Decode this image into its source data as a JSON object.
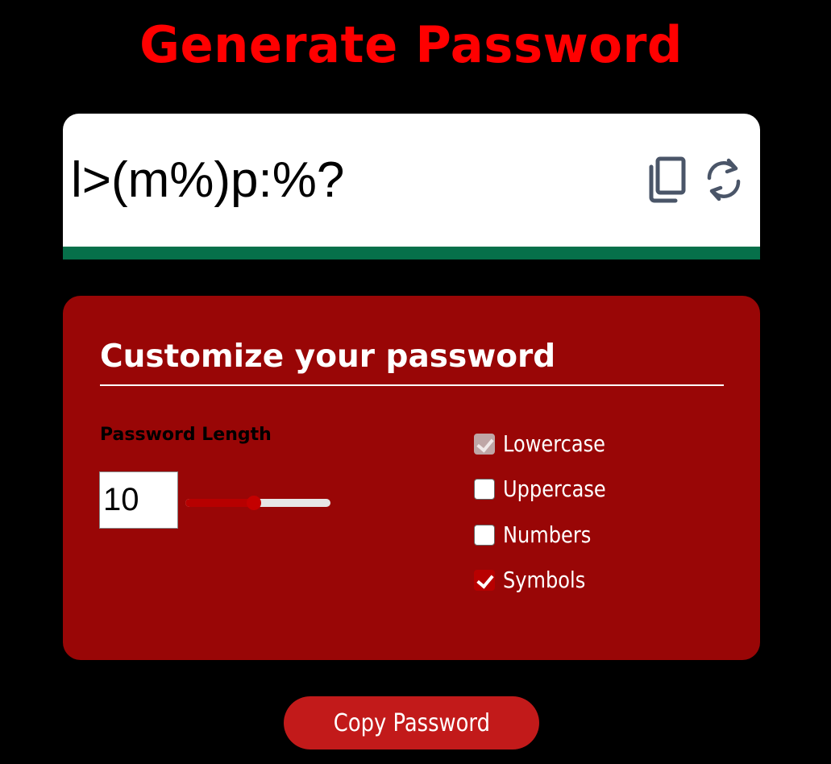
{
  "header": {
    "title": "Generate Password"
  },
  "password_display": {
    "value": "l>(m%)p:%?",
    "strength_fraction": 1.0,
    "strength_color": "#06704a",
    "icons": [
      "copy-icon",
      "refresh-icon"
    ],
    "icon_color": "#4a5568"
  },
  "settings": {
    "title": "Customize your password",
    "length_label": "Password Length",
    "length_value": "10",
    "slider": {
      "min": 1,
      "max": 20,
      "value": 10,
      "fill_color": "#b70000"
    },
    "options": [
      {
        "label": "Lowercase",
        "checked": true,
        "disabled": true
      },
      {
        "label": "Uppercase",
        "checked": false,
        "disabled": false
      },
      {
        "label": "Numbers",
        "checked": false,
        "disabled": false
      },
      {
        "label": "Symbols",
        "checked": true,
        "disabled": false
      }
    ],
    "card_color": "#990606"
  },
  "footer": {
    "copy_button_label": "Copy Password"
  },
  "colors": {
    "background": "#000000",
    "title": "#ff0000",
    "button": "#c21a1a"
  }
}
